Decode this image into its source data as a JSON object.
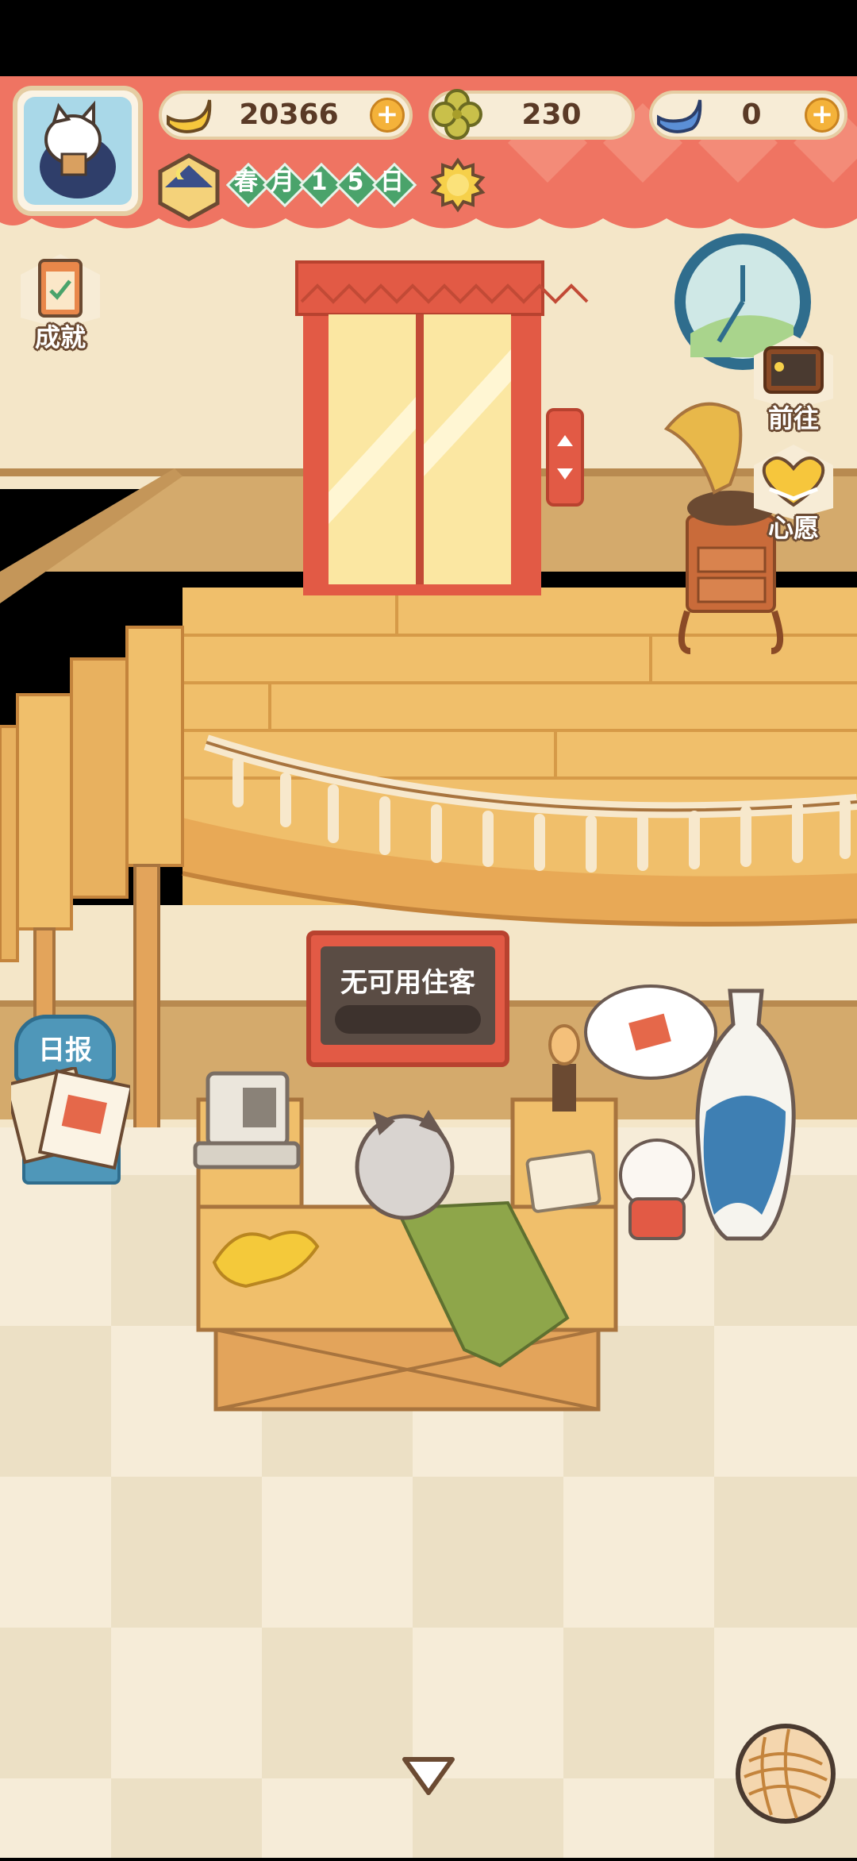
{
  "resources": {
    "banana": {
      "value": "20366",
      "icon": "banana-icon"
    },
    "clover": {
      "value": "230",
      "icon": "clover-icon"
    },
    "blue_banana": {
      "value": "0",
      "icon": "blue-banana-icon"
    },
    "plus_label": "+"
  },
  "calendar": {
    "chars": [
      "春",
      "月",
      "1",
      "5",
      "日"
    ],
    "weather_icon": "sun-icon",
    "time_icon": "moon-clock-icon"
  },
  "side_buttons": {
    "achievements": "成就",
    "goto": "前往",
    "wishes": "心愿"
  },
  "notice_board": {
    "text": "无可用住客"
  },
  "daily_paper": {
    "label": "日报"
  },
  "colors": {
    "banner": "#ef7462",
    "wall": "#f4e6c8",
    "floor_wood": "#f0bf6b",
    "accent_green": "#4aa36b"
  }
}
